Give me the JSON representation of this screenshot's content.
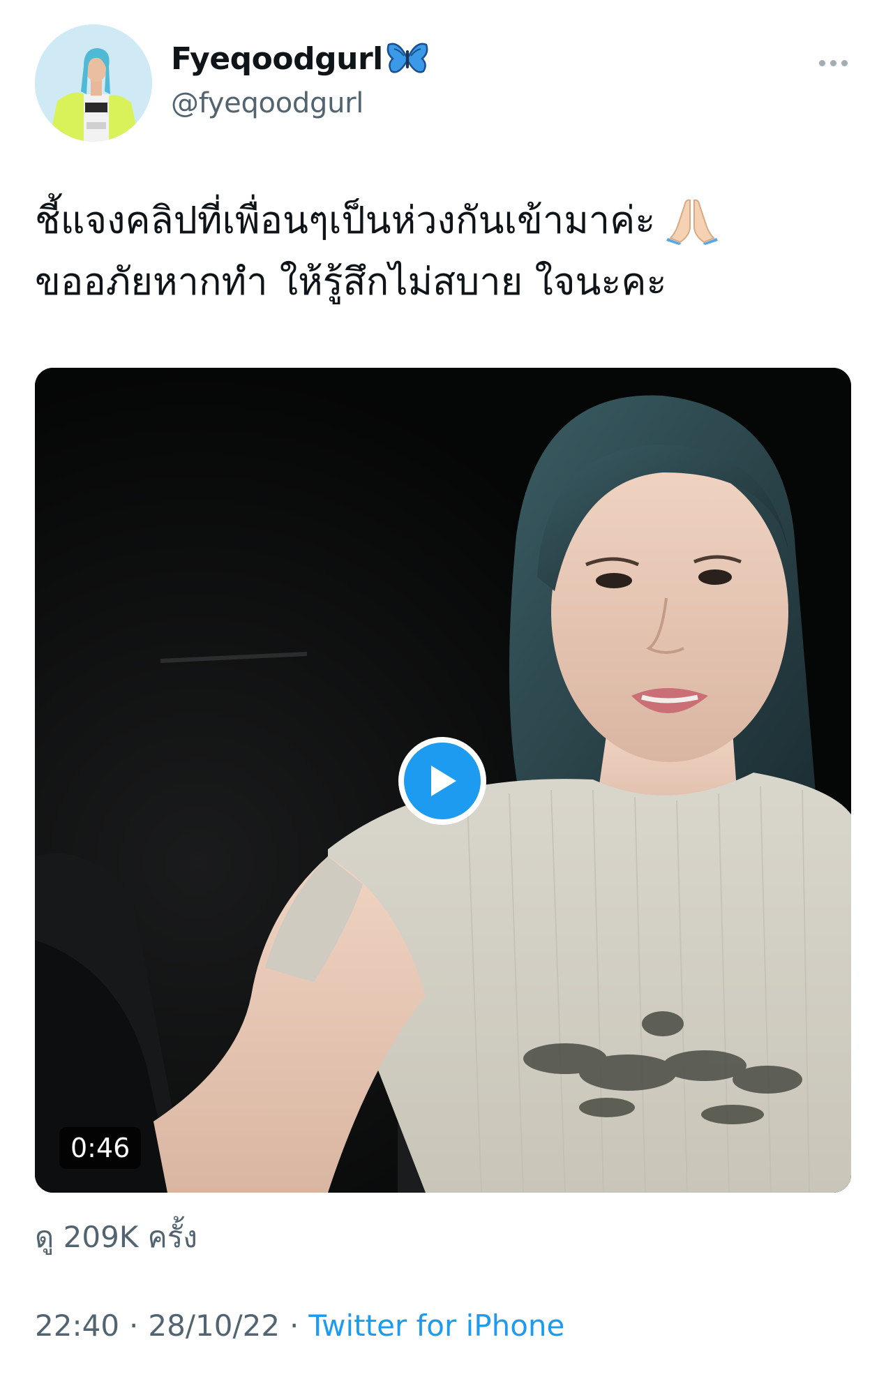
{
  "author": {
    "display_name": "Fyeqoodgurl",
    "handle": "@fyeqoodgurl",
    "verified_emoji": "butterfly-icon",
    "avatar": "avatar-photo"
  },
  "tweet": {
    "text_line_1": "ชี้แจงคลิปที่เพื่อนๆเป็นห่วงกันเข้ามาค่ะ",
    "text_line_2": "ขออภัยหากทำ ให้รู้สึกไม่สบาย ใจนะคะ",
    "emoji": "folded-hands-icon"
  },
  "media": {
    "type": "video",
    "duration": "0:46",
    "play_icon": "play-icon"
  },
  "stats": {
    "views": "ดู 209K ครั้ง"
  },
  "meta": {
    "time": "22:40",
    "separator": "·",
    "date": "28/10/22",
    "source": "Twitter for iPhone"
  },
  "colors": {
    "link": "#1d9bf0",
    "secondary_text": "#536471",
    "primary_text": "#0f1419"
  }
}
